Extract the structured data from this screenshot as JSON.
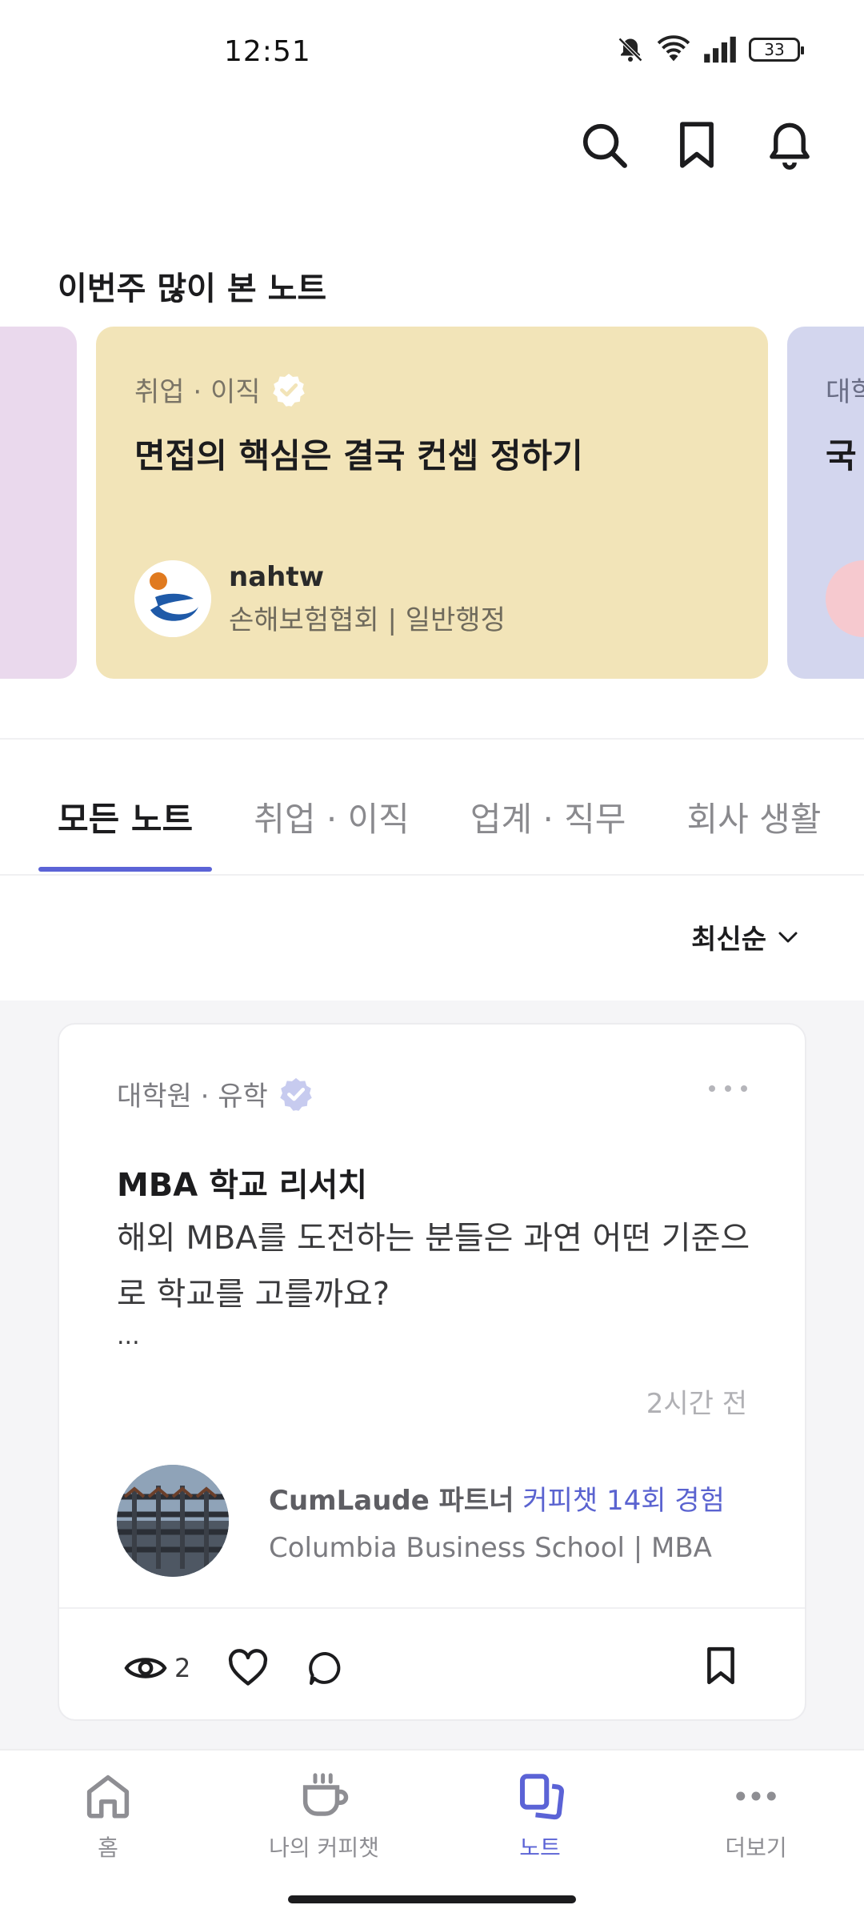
{
  "status_bar": {
    "time": "12:51",
    "battery": "33",
    "icons": [
      "mute-icon",
      "wifi-icon",
      "signal-icon",
      "battery-icon"
    ]
  },
  "header": {
    "actions": [
      "search-icon",
      "bookmark-icon",
      "bell-icon"
    ]
  },
  "popular": {
    "title": "이번주 많이 본 노트",
    "cards": [
      {
        "category": "취업 · 이직",
        "title": "면접의 핵심은 결국 컨셉 정하기",
        "author": "nahtw",
        "author_org": "손해보험협회 | 일반행정",
        "color": "#f2e4b8"
      },
      {
        "category": "대학",
        "title": "국",
        "color": "#d3d6ee"
      }
    ]
  },
  "tabs": [
    "모든 노트",
    "취업 · 이직",
    "업계 · 직무",
    "회사 생활"
  ],
  "sort": {
    "label": "최신순"
  },
  "note": {
    "category": "대학원 · 유학",
    "title": "MBA 학교 리서치",
    "body": "해외 MBA를 도전하는 분들은 과연 어떤 기준으로 학교를 고를까요?",
    "ellipsis": "...",
    "time": "2시간 전",
    "author_name": "CumLaude 파트너",
    "author_badge": "커피챗 14회 경험",
    "author_org": "Columbia Business School | MBA",
    "views": "2"
  },
  "bottom_nav": [
    {
      "label": "홈",
      "icon": "home-icon"
    },
    {
      "label": "나의 커피챗",
      "icon": "coffee-cup-icon"
    },
    {
      "label": "노트",
      "icon": "notes-icon"
    },
    {
      "label": "더보기",
      "icon": "more-icon"
    }
  ],
  "colors": {
    "accent": "#5b63d6",
    "feed_background": "#f5f5f7"
  }
}
